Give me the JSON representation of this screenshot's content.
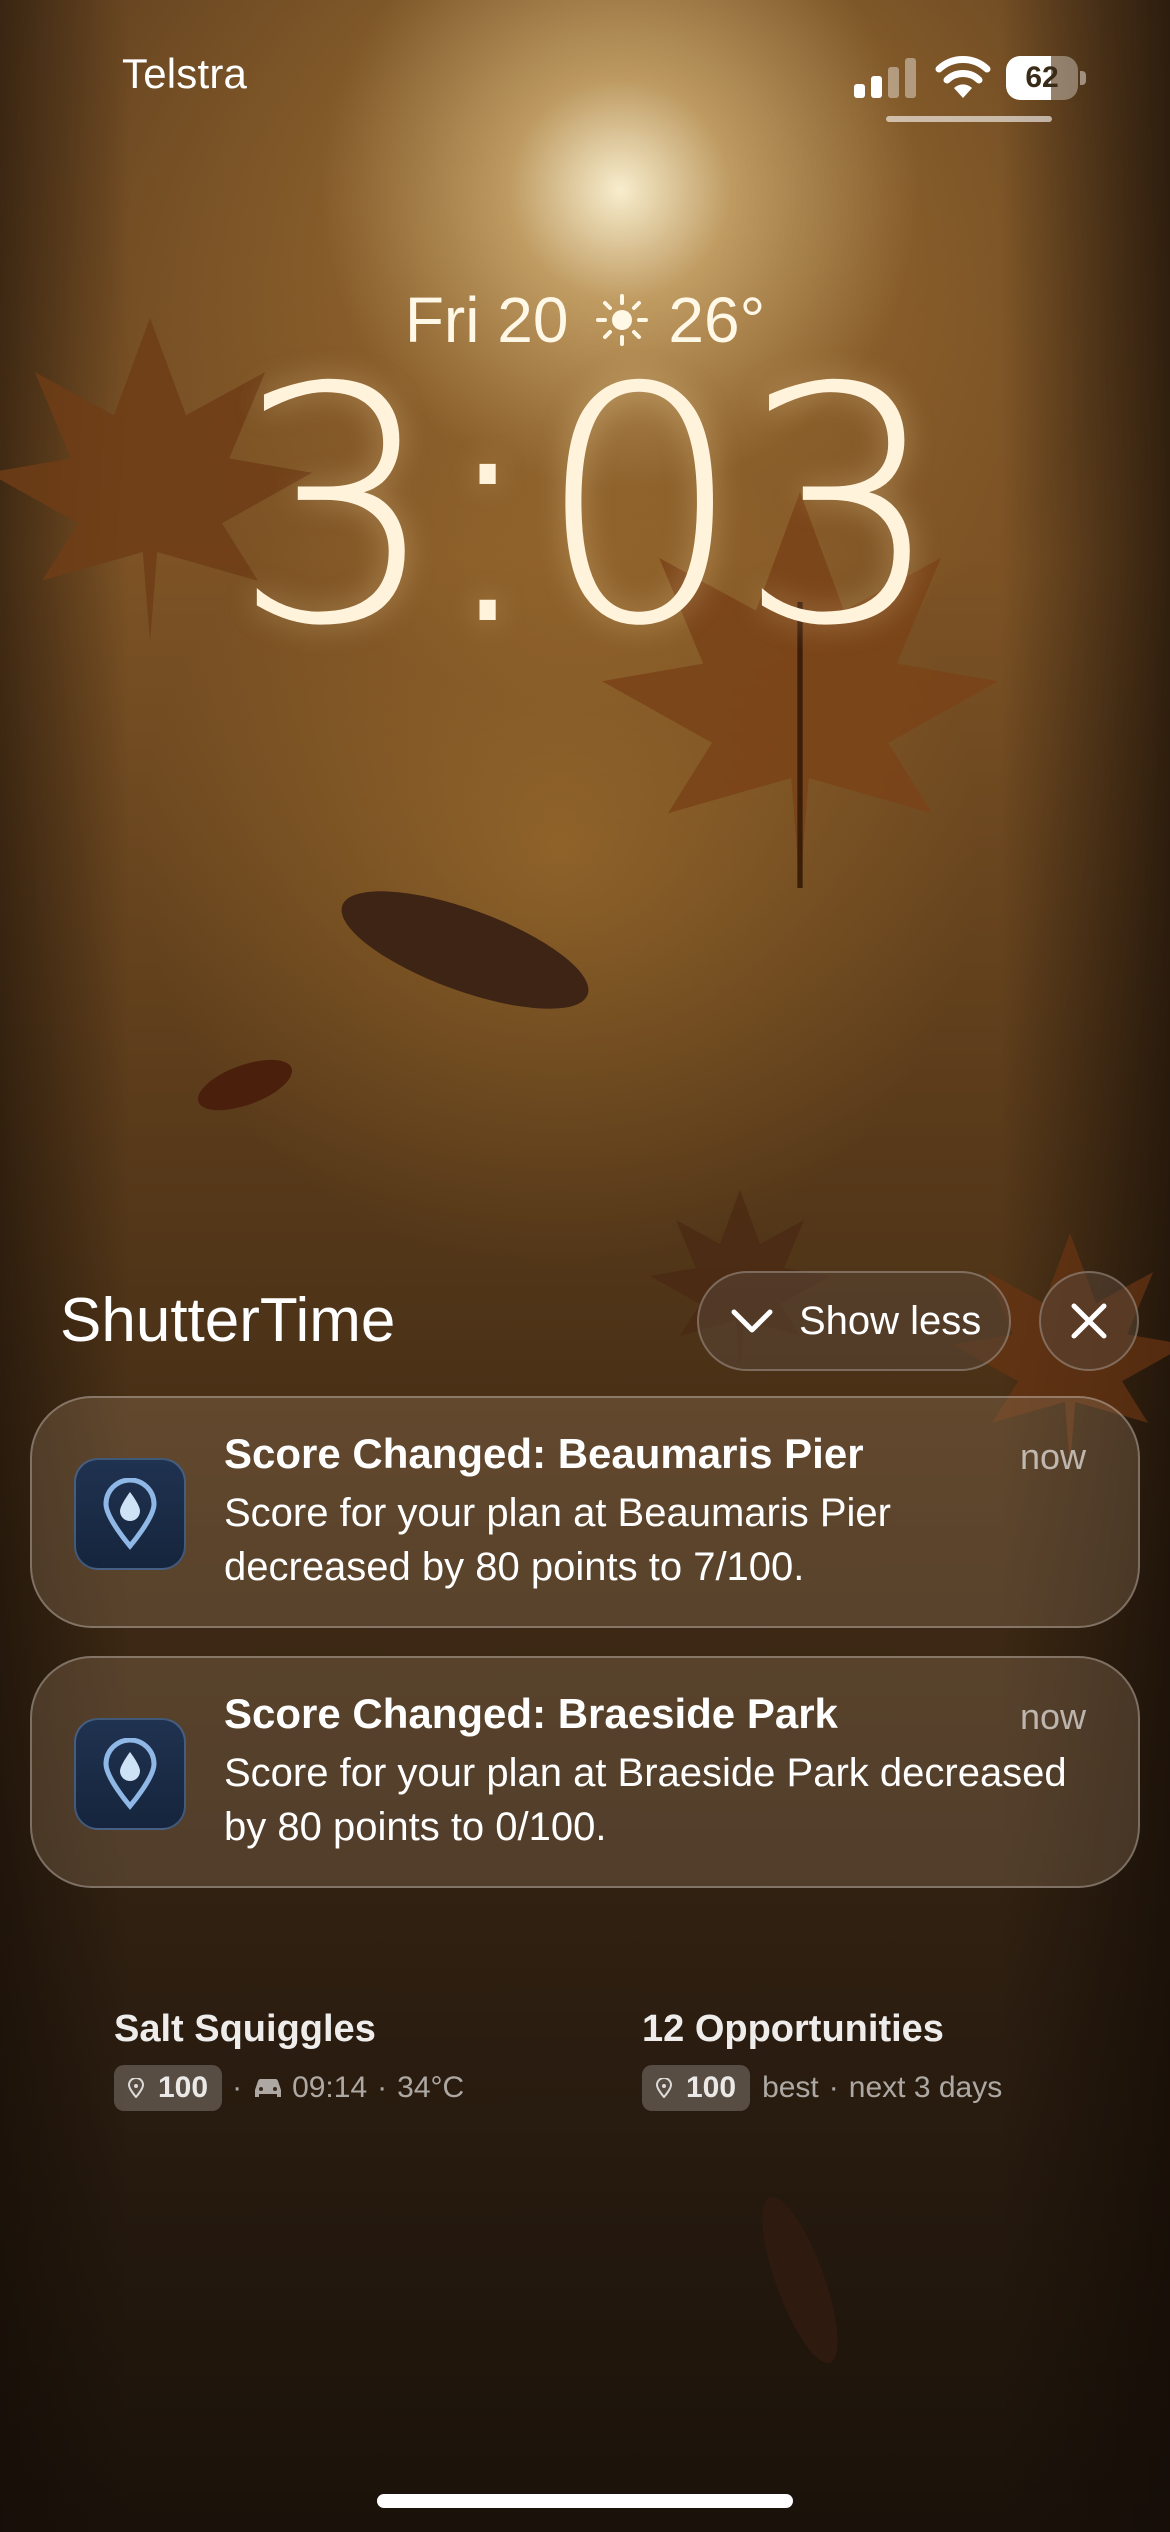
{
  "status_bar": {
    "carrier": "Telstra",
    "signal_icon": "cellular-signal-icon",
    "wifi_icon": "wifi-icon",
    "battery_percent": "62",
    "battery_level": 0.62
  },
  "lock_screen": {
    "date": "Fri 20",
    "weather_icon": "sun-icon",
    "temperature": "26°",
    "time": "3:03"
  },
  "notification_group": {
    "app_name": "ShutterTime",
    "show_less_label": "Show less",
    "close_icon": "close-icon",
    "items": [
      {
        "app_icon": "location-pin-droplet-icon",
        "title": "Score Changed: Beaumaris Pier",
        "time": "now",
        "body": "Score for your plan at Beaumaris Pier decreased by 80 points to 7/100."
      },
      {
        "app_icon": "location-pin-droplet-icon",
        "title": "Score Changed: Braeside Park",
        "time": "now",
        "body": "Score for your plan at Braeside Park decreased by 80 points to 0/100."
      }
    ]
  },
  "widgets": [
    {
      "title": "Salt Squiggles",
      "score": "100",
      "car_icon": "car-icon",
      "drive_time": "09:14",
      "temperature": "34°C"
    },
    {
      "title": "12 Opportunities",
      "score": "100",
      "qualifier": "best",
      "period": "next 3 days"
    }
  ],
  "colors": {
    "time_text": "#fff3dc",
    "app_icon_bg": "#1f3250",
    "notification_bg": "rgba(150,120,95,0.33)"
  }
}
